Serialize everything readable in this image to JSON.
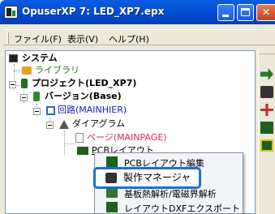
{
  "window": {
    "title": "OpuserXP 7: LED_XP7.epx",
    "minimize_label": "_",
    "close_label": "✕"
  },
  "menubar": {
    "items": [
      {
        "label": "ファイル(F)"
      },
      {
        "label": "表示(V)"
      },
      {
        "label": "ヘルプ(H)"
      }
    ]
  },
  "tree": {
    "system": "システム",
    "library": "ライブラリ",
    "project": "プロジェクト(LED_XP7)",
    "version": "バージョン(Base)",
    "circuit": "回路(MAINHIER)",
    "diagram": "ダイアグラム",
    "page": "ページ(MAINPAGE)",
    "pcb_layout": "PCBレイアウト"
  },
  "context_menu": {
    "items": [
      {
        "label": "PCBレイアウト編集"
      },
      {
        "label": "製作マネージャ"
      },
      {
        "label": "基板熱解析/電磁界解析"
      },
      {
        "label": "レイアウトDXFエクスポート"
      }
    ]
  },
  "colors": {
    "title_bar": "#0451d6",
    "highlight_border": "#1a6fd6",
    "link_blue": "#1a1ad0",
    "page_red": "#e0245c",
    "library_green": "#1e7e1e"
  }
}
